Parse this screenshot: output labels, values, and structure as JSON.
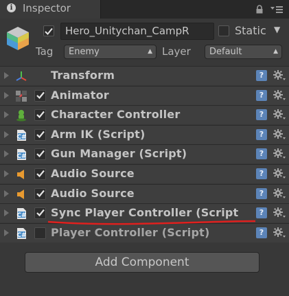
{
  "tab": {
    "title": "Inspector",
    "info_glyph": "i"
  },
  "header": {
    "icons": [
      "info-icon",
      "lock-icon",
      "menu-icon",
      "gameobject-cube-icon"
    ],
    "name_value": "Hero_Unitychan_CampR",
    "active_checked": true,
    "static_label": "Static",
    "static_checked": false,
    "tag_label": "Tag",
    "tag_value": "Enemy",
    "layer_label": "Layer",
    "layer_value": "Default"
  },
  "components": [
    {
      "name": "Transform",
      "icon": "transform-icon",
      "has_checkbox": false,
      "checked": false,
      "expanded": false
    },
    {
      "name": "Animator",
      "icon": "animator-icon",
      "has_checkbox": true,
      "checked": true,
      "expanded": false
    },
    {
      "name": "Character Controller",
      "icon": "character-controller-icon",
      "has_checkbox": true,
      "checked": true,
      "expanded": false
    },
    {
      "name": "Arm IK (Script)",
      "icon": "script-icon",
      "has_checkbox": true,
      "checked": true,
      "expanded": false
    },
    {
      "name": "Gun Manager (Script)",
      "icon": "script-icon",
      "has_checkbox": true,
      "checked": true,
      "expanded": false
    },
    {
      "name": "Audio Source",
      "icon": "audio-source-icon",
      "has_checkbox": true,
      "checked": true,
      "expanded": false
    },
    {
      "name": "Audio Source",
      "icon": "audio-source-icon",
      "has_checkbox": true,
      "checked": true,
      "expanded": false
    },
    {
      "name": "Sync Player Controller (Script",
      "icon": "script-icon",
      "has_checkbox": true,
      "checked": true,
      "expanded": false,
      "highlighted": true
    },
    {
      "name": "Player Controller (Script)",
      "icon": "script-icon",
      "has_checkbox": true,
      "checked": false,
      "expanded": false
    }
  ],
  "row_icons": {
    "help": "help-book-icon",
    "help_glyph": "?",
    "settings": "gear-icon"
  },
  "annotation": {
    "color": "#e0201e"
  },
  "add_component_label": "Add Component",
  "colors": {
    "background": "#383838",
    "row": "#3e3e3e",
    "help": "#5c84b8",
    "text": "#c4c4c4"
  }
}
